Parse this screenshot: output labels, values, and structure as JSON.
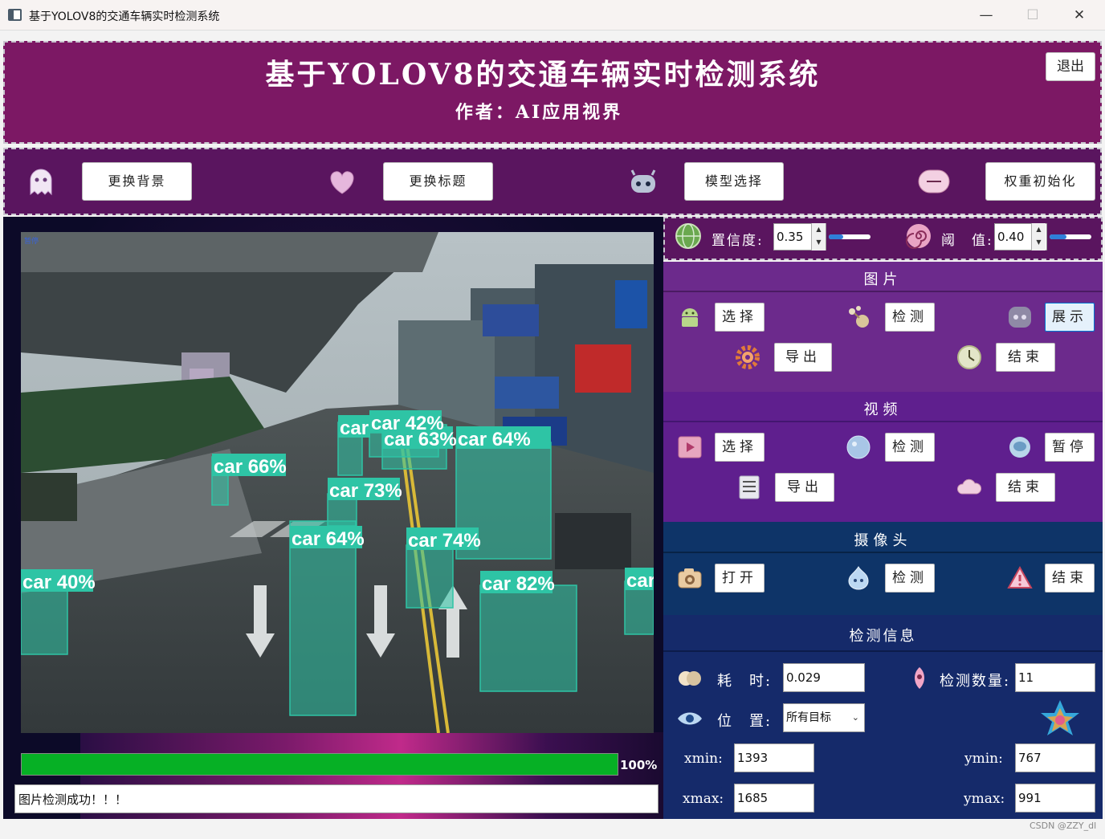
{
  "window": {
    "title": "基于YOLOV8的交通车辆实时检测系统",
    "minimize": "—",
    "maximize": "☐",
    "close": "✕"
  },
  "header": {
    "title": "基于YOLOV8的交通车辆实时检测系统",
    "subtitle": "作者：AI应用视界",
    "exit": "退出"
  },
  "toolbar": {
    "change_bg": "更换背景",
    "change_title": "更换标题",
    "model_select": "模型选择",
    "weight_init": "权重初始化"
  },
  "video": {
    "tag": "暂停",
    "detections": [
      {
        "label": "car 42%"
      },
      {
        "label": "car 63%"
      },
      {
        "label": "car 64%"
      },
      {
        "label": "car 66%"
      },
      {
        "label": "car 73%"
      },
      {
        "label": "car 64%"
      },
      {
        "label": "car 74%"
      },
      {
        "label": "car 82%"
      },
      {
        "label": "car 40%"
      },
      {
        "label": "car"
      },
      {
        "label": "car"
      }
    ]
  },
  "progress": {
    "value": 100,
    "text": "100%"
  },
  "status": "图片检测成功！！！",
  "params": {
    "confidence_label": "置信度:",
    "confidence": "0.35",
    "confidence_level": 0.35,
    "threshold_label": "阈　值:",
    "threshold": "0.40",
    "threshold_level": 0.4
  },
  "image": {
    "header": "图片",
    "select": "选择",
    "detect": "检测",
    "show": "展示",
    "export": "导出",
    "end": "结束"
  },
  "video_sec": {
    "header": "视频",
    "select": "选择",
    "detect": "检测",
    "pause": "暂停",
    "export": "导出",
    "end": "结束"
  },
  "camera": {
    "header": "摄像头",
    "open": "打开",
    "detect": "检测",
    "end": "结束"
  },
  "info": {
    "header": "检测信息",
    "time_label": "耗　时:",
    "time": "0.029",
    "count_label": "检测数量:",
    "count": "11",
    "pos_label": "位　置:",
    "pos": "所有目标",
    "xmin_label": "xmin:",
    "xmin": "1393",
    "ymin_label": "ymin:",
    "ymin": "767",
    "xmax_label": "xmax:",
    "xmax": "1685",
    "ymax_label": "ymax:",
    "ymax": "991"
  },
  "watermark": "CSDN @ZZY_dl",
  "colors": {
    "header_bg": "#7c1864",
    "toolbar_bg": "#5a155f",
    "image_sec": "#6c2a8c",
    "video_sec": "#5f1f8e",
    "camera_sec": "#0e3468",
    "info_sec": "#152a6a",
    "progress": "#06b025",
    "box": "#2ec4a5"
  }
}
